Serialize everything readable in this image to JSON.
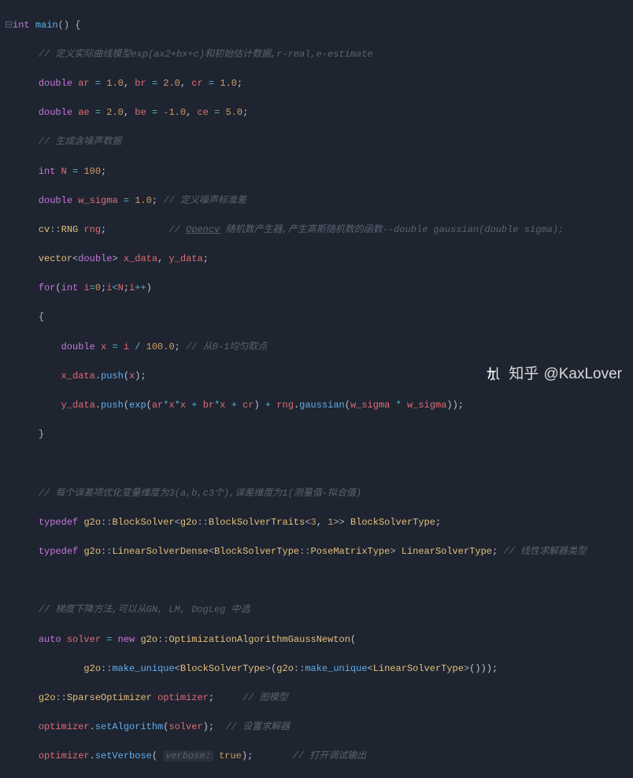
{
  "watermark": {
    "site": "知乎",
    "handle": "@KaxLover"
  },
  "code": {
    "l1": {
      "kw1": "int",
      "fn": "main",
      "p": "() {"
    },
    "l2": {
      "cm": "// 定义实际曲线模型exp(ax2+bx+c)和初始估计数据,r-real,e-estimate"
    },
    "l3": {
      "kw": "double",
      "v1": "ar",
      "n1": "1.0",
      "v2": "br",
      "n2": "2.0",
      "v3": "cr",
      "n3": "1.0"
    },
    "l4": {
      "kw": "double",
      "v1": "ae",
      "n1": "2.0",
      "v2": "be",
      "n2": "-1.0",
      "v3": "ce",
      "n3": "5.0"
    },
    "l5": {
      "cm": "// 生成含噪声数据"
    },
    "l6": {
      "kw": "int",
      "v": "N",
      "n": "100"
    },
    "l7": {
      "kw": "double",
      "v": "w_sigma",
      "n": "1.0",
      "cm": "// 定义噪声标准差"
    },
    "l8": {
      "ns": "cv",
      "ty": "RNG",
      "v": "rng",
      "cm": "// Opencv 随机数产生器,产生高斯随机数的函数--double gaussian(double sigma);"
    },
    "l9": {
      "ty": "vector",
      "tp": "double",
      "v1": "x_data",
      "v2": "y_data"
    },
    "l10": {
      "kw": "for",
      "kw2": "int",
      "v": "i",
      "n1": "0",
      "v2": "N"
    },
    "l11": {
      "b": "{"
    },
    "l12": {
      "kw": "double",
      "v": "x",
      "v2": "i",
      "n": "100.0",
      "cm": "// 从0-1均匀取点"
    },
    "l13": {
      "v": "x_data",
      "fn": "push",
      "arg": "x"
    },
    "l14": {
      "v": "y_data",
      "fn": "push",
      "fn2": "exp",
      "a": "ar",
      "b": "br",
      "c": "cr",
      "r": "rng",
      "g": "gaussian",
      "w": "w_sigma"
    },
    "l15": {
      "b": "}"
    },
    "l16": {
      "cm": "// 每个误差项优化变量维度为3(a,b,c3个),误差维度为1(测量值-拟合值)"
    },
    "l17": {
      "kw": "typedef",
      "ns": "g2o",
      "ty": "BlockSolver",
      "ns2": "g2o",
      "ty2": "BlockSolverTraits",
      "n1": "3",
      "n2": "1",
      "alias": "BlockSolverType"
    },
    "l18": {
      "kw": "typedef",
      "ns": "g2o",
      "ty": "LinearSolverDense",
      "tp": "BlockSolverType",
      "tp2": "PoseMatrixType",
      "alias": "LinearSolverType",
      "cm": "// 线性求解器类型"
    },
    "l19": {
      "cm": "// 梯度下降方法,可以从GN, LM, DogLeg 中选"
    },
    "l20": {
      "kw": "auto",
      "v": "solver",
      "kw2": "new",
      "ns": "g2o",
      "ty": "OptimizationAlgorithmGaussNewton"
    },
    "l21": {
      "ns": "g2o",
      "fn": "make_unique",
      "tp": "BlockSolverType",
      "ns2": "g2o",
      "fn2": "make_unique",
      "tp2": "LinearSolverType"
    },
    "l22": {
      "ns": "g2o",
      "ty": "SparseOptimizer",
      "v": "optimizer",
      "cm": "// 图模型"
    },
    "l23": {
      "v": "optimizer",
      "fn": "setAlgorithm",
      "arg": "solver",
      "cm": "// 设置求解器"
    },
    "l24": {
      "v": "optimizer",
      "fn": "setVerbose",
      "hint": "verbose:",
      "b": "true",
      "cm": "// 打开调试输出"
    }
  }
}
